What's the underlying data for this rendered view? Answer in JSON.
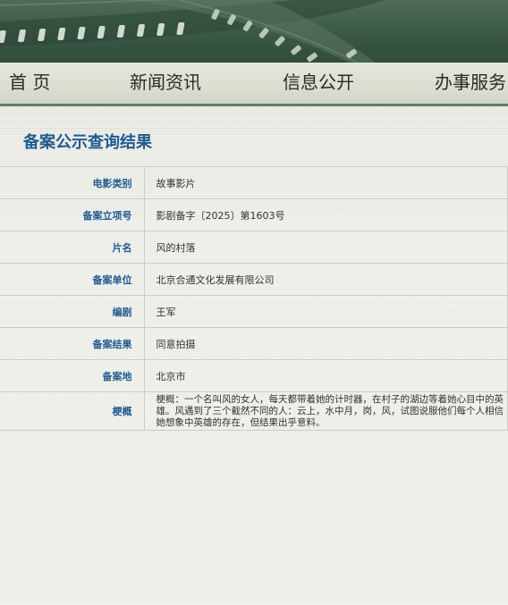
{
  "nav": {
    "items": [
      {
        "label": "首 页"
      },
      {
        "label": "新闻资讯"
      },
      {
        "label": "信息公开"
      },
      {
        "label": "办事服务"
      }
    ]
  },
  "main": {
    "title": "备案公示查询结果",
    "rows": [
      {
        "label": "电影类别",
        "value": "故事影片"
      },
      {
        "label": "备案立项号",
        "value": "影剧备字〔2025〕第1603号"
      },
      {
        "label": "片名",
        "value": "风的村落"
      },
      {
        "label": "备案单位",
        "value": "北京合通文化发展有限公司"
      },
      {
        "label": "编剧",
        "value": "王军"
      },
      {
        "label": "备案结果",
        "value": "同意拍摄"
      },
      {
        "label": "备案地",
        "value": "北京市"
      },
      {
        "label": "梗概",
        "value": "梗概：一个名叫风的女人，每天都带着她的计时器，在村子的湖边等着她心目中的英雄。风遇到了三个截然不同的人：云上，水中月，岗，风，试图说服他们每个人相信她想象中英雄的存在，但结果出乎意料。"
      }
    ]
  },
  "colors": {
    "accent": "#1f5a94",
    "banner": "#3e5c4a",
    "nav_border": "#657d6b"
  }
}
